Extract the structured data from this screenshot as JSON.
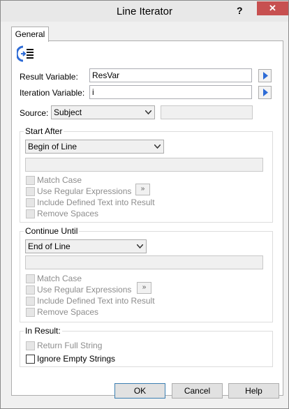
{
  "window": {
    "title": "Line Iterator",
    "help_glyph": "?",
    "close_glyph": "✕"
  },
  "tabs": [
    {
      "label": "General"
    }
  ],
  "fields": {
    "result_variable": {
      "label": "Result Variable:",
      "value": "ResVar"
    },
    "iteration_variable": {
      "label": "Iteration Variable:",
      "value": "i"
    },
    "source": {
      "label": "Source:",
      "value": "Subject",
      "extra": ""
    }
  },
  "start_after": {
    "title": "Start After",
    "mode": "Begin of Line",
    "text": "",
    "options": {
      "match_case": "Match Case",
      "use_regex": "Use Regular Expressions",
      "include_text": "Include Defined Text into Result",
      "remove_spaces": "Remove Spaces"
    },
    "expand_glyph": "»"
  },
  "continue_until": {
    "title": "Continue Until",
    "mode": "End of Line",
    "text": "",
    "options": {
      "match_case": "Match Case",
      "use_regex": "Use Regular Expressions",
      "include_text": "Include Defined Text into Result",
      "remove_spaces": "Remove Spaces"
    },
    "expand_glyph": "»"
  },
  "in_result": {
    "title": "In Result:",
    "return_full": "Return Full String",
    "ignore_empty": "Ignore Empty Strings"
  },
  "buttons": {
    "ok": "OK",
    "cancel": "Cancel",
    "help": "Help"
  },
  "colors": {
    "accent_blue": "#2d6bd6",
    "close_red": "#c75050"
  }
}
